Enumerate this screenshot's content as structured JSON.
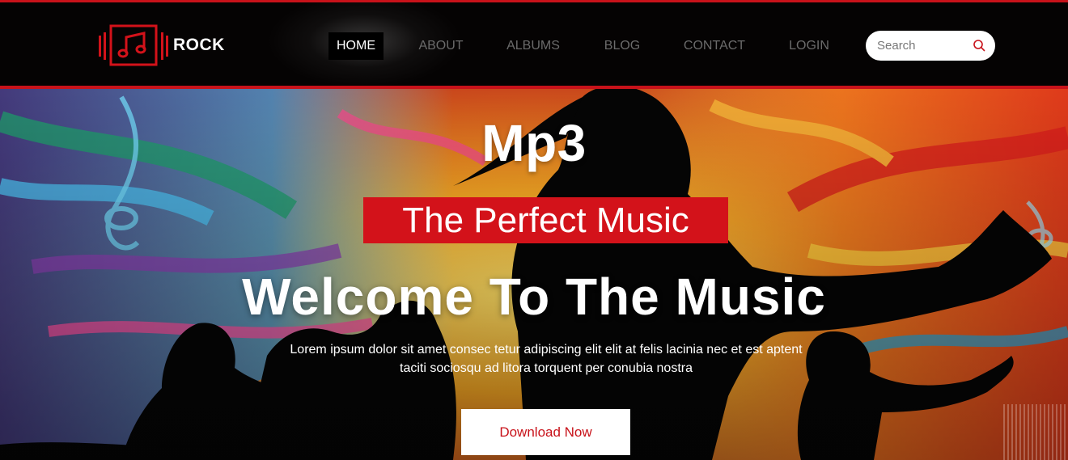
{
  "brand": {
    "logo_text": "ROCK",
    "accent": "#c8121a"
  },
  "nav": {
    "items": [
      {
        "label": "HOME",
        "active": true
      },
      {
        "label": "ABOUT",
        "active": false
      },
      {
        "label": "ALBUMS",
        "active": false
      },
      {
        "label": "BLOG",
        "active": false
      },
      {
        "label": "CONTACT",
        "active": false
      },
      {
        "label": "LOGIN",
        "active": false
      }
    ]
  },
  "search": {
    "placeholder": "Search",
    "value": "",
    "icon": "search-icon"
  },
  "hero": {
    "title": "Mp3",
    "badge": "The Perfect Music",
    "heading": "Welcome To The Music",
    "paragraph": "Lorem ipsum dolor sit amet consec tetur adipiscing elit elit at felis lacinia nec et est aptent taciti sociosqu ad litora torquent per conubia nostra",
    "button_label": "Download Now"
  }
}
